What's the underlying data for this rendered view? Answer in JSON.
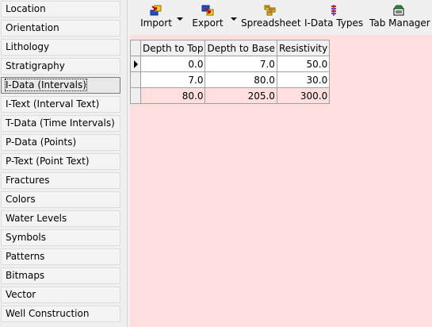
{
  "sidebar": {
    "items": [
      {
        "label": "Location"
      },
      {
        "label": "Orientation"
      },
      {
        "label": "Lithology"
      },
      {
        "label": "Stratigraphy"
      },
      {
        "label": "I-Data (Intervals)"
      },
      {
        "label": "I-Text (Interval Text)"
      },
      {
        "label": "T-Data (Time Intervals)"
      },
      {
        "label": "P-Data (Points)"
      },
      {
        "label": "P-Text (Point Text)"
      },
      {
        "label": "Fractures"
      },
      {
        "label": "Colors"
      },
      {
        "label": "Water Levels"
      },
      {
        "label": "Symbols"
      },
      {
        "label": "Patterns"
      },
      {
        "label": "Bitmaps"
      },
      {
        "label": "Vector"
      },
      {
        "label": "Well Construction"
      }
    ],
    "selected_index": 4
  },
  "toolbar": {
    "import_label": "Import",
    "export_label": "Export",
    "spreadsheet_label": "Spreadsheet",
    "idata_types_label": "I-Data Types",
    "tab_manager_label": "Tab Manager",
    "icons": {
      "import": "import-icon",
      "export": "export-icon",
      "spreadsheet": "spreadsheet-icon",
      "idata_types": "idata-types-icon",
      "tab_manager": "tab-manager-icon"
    }
  },
  "grid": {
    "headers": [
      "Depth to Top",
      "Depth to Base",
      "Resistivity"
    ],
    "rows": [
      [
        "0.0",
        "7.0",
        "50.0"
      ],
      [
        "7.0",
        "80.0",
        "30.0"
      ],
      [
        "80.0",
        "205.0",
        "300.0"
      ]
    ],
    "current_row": 0
  },
  "colors": {
    "grid_background": "#ffdede",
    "sidebar_background": "#f0f0f0"
  }
}
